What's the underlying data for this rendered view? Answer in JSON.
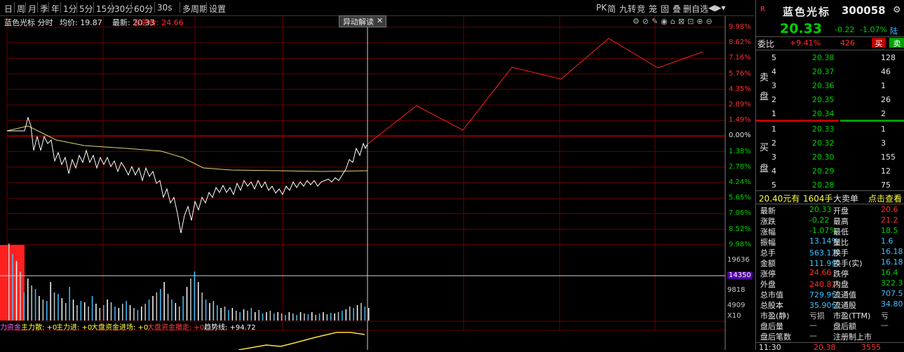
{
  "toolbar": {
    "items": [
      "日",
      "周",
      "月",
      "季",
      "年",
      "1分",
      "5分",
      "15分",
      "30分",
      "60分",
      "30s",
      "多周期",
      "设置"
    ],
    "right_items": [
      "PK",
      "简",
      "九转",
      "竞",
      "笼",
      "固",
      "叠",
      "删自选"
    ]
  },
  "infobar": {
    "stock": "蓝色光标 分时",
    "avg_label": "均价: 19.87",
    "latest_label": "最新: 20.33",
    "limit_label": "涨停价: 24.66"
  },
  "popup": {
    "label": "异动解读",
    "close": "✕"
  },
  "price_axis": {
    "right_labels": [
      "9.98%",
      "8.62%",
      "7.16%",
      "5.76%",
      "4.35%",
      "2.89%",
      "1.49%",
      "0.00%",
      "1.38%",
      "2.78%",
      "4.24%",
      "5.65%",
      "7.06%",
      "8.52%",
      "9.98%"
    ]
  },
  "volume_axis": {
    "labels": [
      "19636",
      "14350",
      "9818",
      "4909",
      "X10"
    ]
  },
  "indicator_bar": {
    "prefix": "力资金",
    "main_force": "主力散: +0",
    "main_force2": "主力进: +0",
    "market_in": "大盘资金进场: +0",
    "market_out": "大盘资金撤走: +0",
    "trend": "趋势线: +94.72"
  },
  "quote": {
    "code_badge": "R",
    "name": "蓝色光标",
    "code": "300058",
    "price": "20.33",
    "change": "-0.22",
    "change_pct": "-1.07%",
    "flag": "陆",
    "weibi_label": "委比",
    "weibi": "+9.41%",
    "weicha": "426",
    "buy_btn": "买",
    "sell_btn": "卖",
    "sell_side_label": [
      "卖",
      "盘"
    ],
    "buy_side_label": [
      "买",
      "盘"
    ],
    "asks": [
      {
        "level": "5",
        "price": "20.38",
        "vol": "128"
      },
      {
        "level": "4",
        "price": "20.37",
        "vol": "46"
      },
      {
        "level": "3",
        "price": "20.36",
        "vol": "1"
      },
      {
        "level": "2",
        "price": "20.35",
        "vol": "26"
      },
      {
        "level": "1",
        "price": "20.34",
        "vol": "2"
      }
    ],
    "bids": [
      {
        "level": "1",
        "price": "20.33",
        "vol": "1"
      },
      {
        "level": "2",
        "price": "20.32",
        "vol": "3"
      },
      {
        "level": "3",
        "price": "20.30",
        "vol": "155"
      },
      {
        "level": "4",
        "price": "20.29",
        "vol": "12"
      },
      {
        "level": "5",
        "price": "20.28",
        "vol": "75"
      }
    ],
    "big_order": {
      "price": "20.40元有",
      "vol": "1604手",
      "type": "大卖单",
      "link": "点击查看"
    },
    "stats": [
      {
        "l1": "最新",
        "v1": "20.33",
        "l2": "开盘",
        "v2": "20.6"
      },
      {
        "l1": "涨跌",
        "v1": "-0.22",
        "l2": "最高",
        "v2": "21.2"
      },
      {
        "l1": "涨幅",
        "v1": "-1.07%",
        "l2": "最低",
        "v2": "18.5"
      },
      {
        "l1": "振幅",
        "v1": "13.14%",
        "l2": "量比",
        "v2": "1.6"
      },
      {
        "l1": "总手",
        "v1": "563.1万",
        "l2": "换手",
        "v2": "16.18"
      },
      {
        "l1": "金额",
        "v1": "111.9亿",
        "l2": "换手(实)",
        "v2": "16.18"
      },
      {
        "l1": "涨停",
        "v1": "24.66",
        "l2": "跌停",
        "v2": "16.4"
      },
      {
        "l1": "外盘",
        "v1": "240.8万",
        "l2": "内盘",
        "v2": "322.3"
      },
      {
        "l1": "总市值",
        "v1": "729.9亿",
        "l2": "流通值",
        "v2": "707.5"
      },
      {
        "l1": "总股本",
        "v1": "35.90亿",
        "l2": "流通股",
        "v2": "34.80"
      },
      {
        "l1": "市盈(静)",
        "v1": "亏损",
        "l2": "市盈(TTM)",
        "v2": "亏"
      },
      {
        "l1": "盘后量",
        "v1": "—",
        "l2": "盘后额",
        "v2": "—"
      },
      {
        "l1": "盘后笔数",
        "v1": "—",
        "l2": "注册制上市",
        "v2": ""
      }
    ],
    "last_tick": {
      "time": "11:30",
      "price": "20.38",
      "vol": "3555"
    }
  },
  "colors": {
    "up": "#ff3030",
    "down": "#00d000",
    "price_line": "#ffffff",
    "avg_line": "#e0d870",
    "grid": "#7a0000"
  }
}
